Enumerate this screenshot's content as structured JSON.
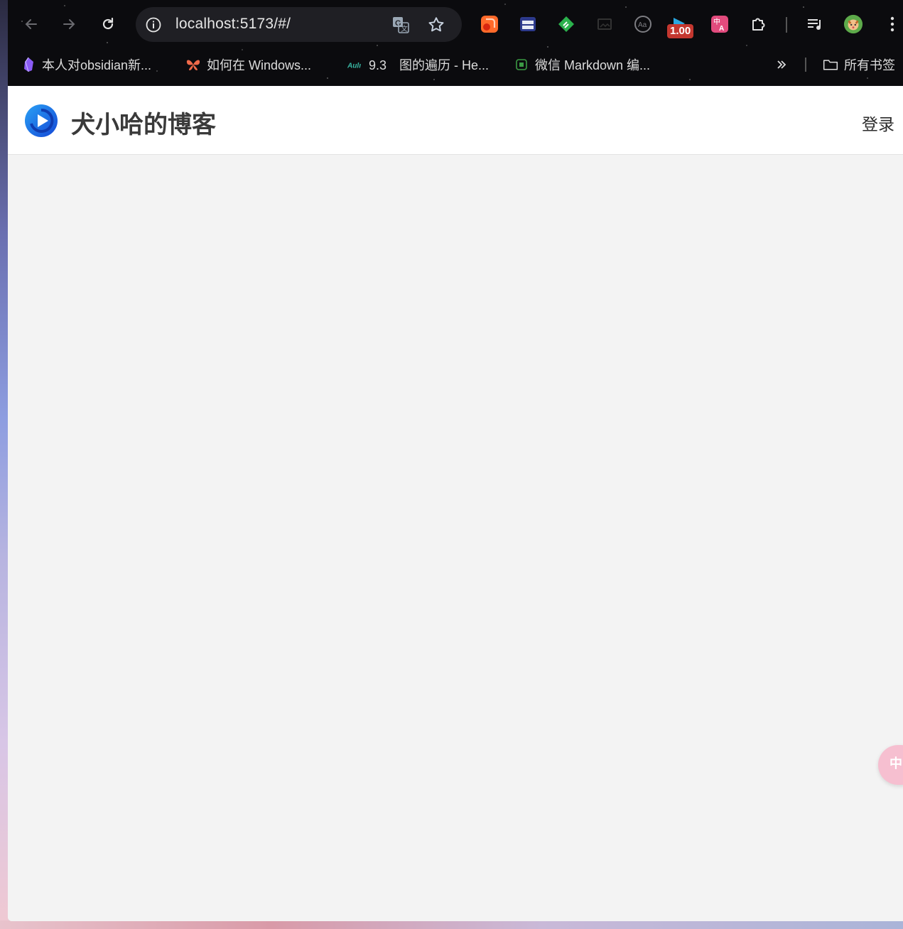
{
  "browser": {
    "url": "localhost:5173/#/",
    "extension_badge": "1.00",
    "bookmarks": [
      {
        "label": "本人对obsidian新...",
        "icon": "obsidian-icon"
      },
      {
        "label": "如何在 Windows...",
        "icon": "butterfly-icon"
      },
      {
        "label": "9.3　图的遍历 - He...",
        "icon": "hello-algo-icon"
      },
      {
        "label": "微信 Markdown 编...",
        "icon": "wechat-editor-icon"
      }
    ],
    "all_bookmarks_label": "所有书签"
  },
  "page": {
    "site_title": "犬小哈的博客",
    "login_label": "登录",
    "float_button_label": "中"
  },
  "colors": {
    "logo_blue": "#1f6fe8",
    "header_bg": "#ffffff",
    "content_bg": "#f3f3f3",
    "badge_red": "#c4372f"
  }
}
